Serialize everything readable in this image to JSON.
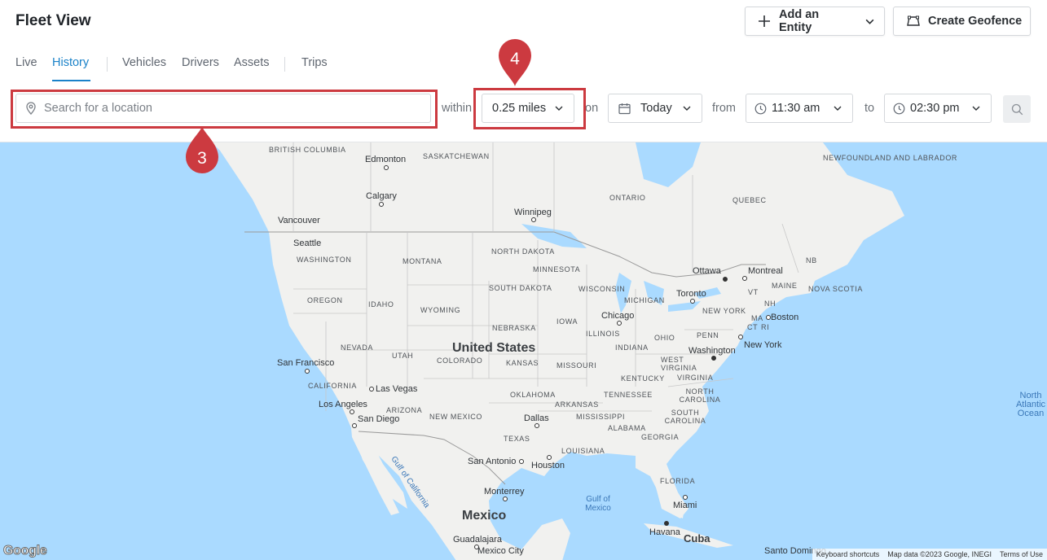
{
  "header": {
    "title": "Fleet View",
    "add_entity_label": "Add an Entity",
    "create_geofence_label": "Create Geofence"
  },
  "tabs": [
    {
      "label": "Live",
      "active": false
    },
    {
      "label": "History",
      "active": true
    },
    {
      "label": "Vehicles",
      "active": false
    },
    {
      "label": "Drivers",
      "active": false
    },
    {
      "label": "Assets",
      "active": false
    },
    {
      "label": "Trips",
      "active": false
    }
  ],
  "filters": {
    "search_placeholder": "Search for a location",
    "within_label": "within",
    "radius_value": "0.25 miles",
    "on_label": "on",
    "date_value": "Today",
    "from_label": "from",
    "from_time": "11:30 am",
    "to_label": "to",
    "to_time": "02:30 pm"
  },
  "callouts": [
    {
      "number": "3"
    },
    {
      "number": "4"
    }
  ],
  "map": {
    "regions": [
      "BRITISH COLUMBIA",
      "SASKATCHEWAN",
      "ONTARIO",
      "QUEBEC",
      "NEWFOUNDLAND AND LABRADOR",
      "NORTH DAKOTA",
      "MONTANA",
      "MINNESOTA",
      "WASHINGTON",
      "SOUTH DAKOTA",
      "WISCONSIN",
      "OREGON",
      "IDAHO",
      "WYOMING",
      "MICHIGAN",
      "NEW YORK",
      "NEBRASKA",
      "IOWA",
      "ILLINOIS",
      "OHIO",
      "PENN",
      "NEVADA",
      "UTAH",
      "COLORADO",
      "KANSAS",
      "MISSOURI",
      "INDIANA",
      "WEST VIRGINIA",
      "VIRGINIA",
      "KENTUCKY",
      "CALIFORNIA",
      "TENNESSEE",
      "NORTH CAROLINA",
      "OKLAHOMA",
      "ARKANSAS",
      "ARIZONA",
      "NEW MEXICO",
      "MISSISSIPPI",
      "SOUTH CAROLINA",
      "ALABAMA",
      "GEORGIA",
      "TEXAS",
      "LOUISIANA",
      "FLORIDA",
      "NB",
      "VT",
      "NH",
      "MAINE",
      "NOVA SCOTIA",
      "MA",
      "CT",
      "RI"
    ],
    "cities": [
      "Edmonton",
      "Calgary",
      "Vancouver",
      "Winnipeg",
      "Seattle",
      "Ottawa",
      "Montreal",
      "Toronto",
      "Chicago",
      "Boston",
      "Washington",
      "New York",
      "San Francisco",
      "Las Vegas",
      "Los Angeles",
      "San Diego",
      "Dallas",
      "San Antonio",
      "Houston",
      "Monterrey",
      "Miami",
      "Havana",
      "Guadalajara",
      "Mexico City",
      "Santo Domingo"
    ],
    "countries": [
      "United States",
      "Mexico",
      "Cuba"
    ],
    "water": [
      "Gulf of Mexico",
      "Gulf of California",
      "North Atlantic Ocean"
    ],
    "footer": {
      "shortcuts": "Keyboard shortcuts",
      "data": "Map data ©2023 Google, INEGI",
      "terms": "Terms of Use"
    },
    "logo": "Google"
  },
  "colors": {
    "accent": "#1a82c9",
    "highlight": "#cc3a40",
    "water": "#aadaff",
    "land": "#f1f1ef"
  }
}
